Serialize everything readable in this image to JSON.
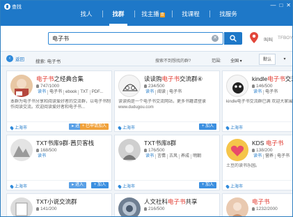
{
  "window": {
    "title": "查找",
    "controls": [
      "—",
      "□",
      "✕"
    ]
  },
  "nav": {
    "tabs": [
      {
        "label": "找人"
      },
      {
        "label": "找群",
        "active": true
      },
      {
        "label": "找主播",
        "badge": "直"
      },
      {
        "label": "找课程"
      },
      {
        "label": "找服务"
      }
    ]
  },
  "search": {
    "value": "电子书",
    "clear_icon": "clear-icon",
    "button_icon": "search-icon",
    "location": "叫叫",
    "location2": "TFBOY"
  },
  "filter": {
    "back_label": "返回",
    "breadcrumb": "搜索: 电子书",
    "hint": "搜索不到想找的群?",
    "range_label": "范围:",
    "range_value": "全国 ▾",
    "sort_default": "默认",
    "sort_other": "▾"
  },
  "groups": [
    {
      "title_pre": "",
      "title_hl": "电子书",
      "title_post": "之经典合集",
      "count": "747/1000",
      "tags": [
        "读书",
        "电子书",
        "ebook",
        "TXT",
        "PDF..."
      ],
      "desc": "本群为电子书分享和阅读爱好者的交流群，以电子书制作阅读交流。欢迎阅读爱好者和电子书...",
      "city": "上海市",
      "btn_enter": "进入",
      "btn_right": "已申请加入",
      "avatar_color": "#e8c7a4"
    },
    {
      "title_pre": "读读购",
      "title_hl": "电子书",
      "title_post": "交流群④",
      "count": "234/500",
      "tags": [
        "读书",
        "阅读",
        "电子书"
      ],
      "desc": "读读购是一个电子书交流网站，更多书籍请登录www.dudugou.com",
      "city": "上海市",
      "btn_right": "加入",
      "avatar_color": "#f2f2f2"
    },
    {
      "title_pre": "kindle",
      "title_hl": "电子书",
      "title_post": "交流群",
      "count": "146/500",
      "tags": [
        "读书",
        "电子书"
      ],
      "desc": "kindle电子书交流群已满 欢迎大家围观...",
      "city": "上海市",
      "btn_right": "加入",
      "avatar_color": "#333333"
    },
    {
      "title_pre": "TXT书库9群·茜贝客栈",
      "title_hl": "",
      "title_post": "",
      "count": "168/500",
      "tags": [
        "读书"
      ],
      "desc": "",
      "city": "上海市",
      "btn_enter": "进入",
      "btn_right": "加入",
      "avatar_color": "#d8d8d8"
    },
    {
      "title_pre": "TXT书库8群",
      "title_hl": "",
      "title_post": "",
      "count": "176/500",
      "tags": [
        "读书",
        "言情",
        "古风",
        "养成",
        "明朝"
      ],
      "desc": "",
      "city": "上海市",
      "btn_right": "加入",
      "avatar_color": "#c0c0c0"
    },
    {
      "title_pre": "KDS ",
      "title_hl": "电子书",
      "title_post": "",
      "count": "138/200",
      "tags": [
        "读书",
        "营养",
        "电子书"
      ],
      "desc": "土豆的读书乐园。",
      "city": "上海市",
      "btn_right": "加入",
      "avatar_color": "#f5c54a"
    },
    {
      "title_pre": "TXT小说交流群",
      "title_hl": "",
      "title_post": "",
      "count": "141/200",
      "tags": [],
      "desc": "",
      "city": "",
      "btn_right": "",
      "avatar_color": "#dcdcdc"
    },
    {
      "title_pre": "人文社科",
      "title_hl": "电子书",
      "title_post": "共享",
      "count": "216/500",
      "tags": [],
      "desc": "",
      "city": "",
      "btn_right": "",
      "avatar_color": "#6f7f92"
    },
    {
      "title_pre": "",
      "title_hl": "电子书",
      "title_post": "",
      "count": "1232/2000",
      "tags": [],
      "desc": "",
      "city": "",
      "btn_right": "",
      "avatar_color": "#e9c9b0"
    }
  ]
}
